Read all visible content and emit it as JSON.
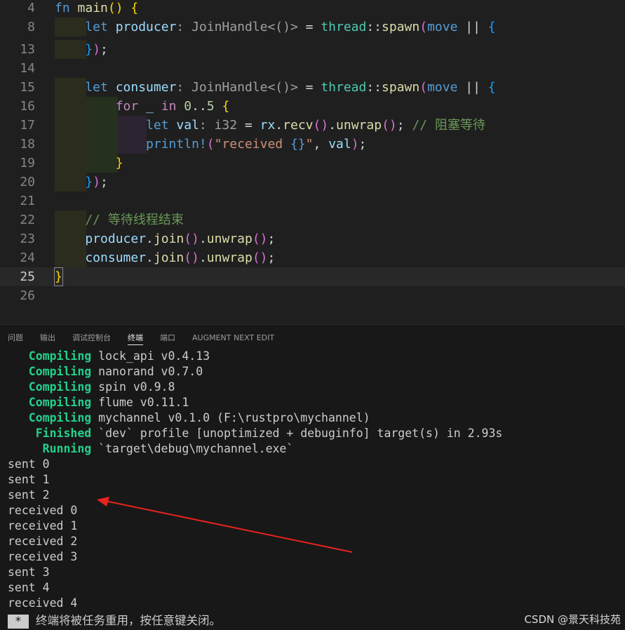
{
  "editor": {
    "lines": [
      {
        "num": "4",
        "parts": [
          [
            "kw",
            "fn "
          ],
          [
            "fn",
            "main"
          ],
          [
            "br1",
            "() {"
          ]
        ]
      },
      {
        "num": "8",
        "parts": [
          [
            "kw",
            "    let "
          ],
          [
            "var",
            "producer"
          ],
          [
            "hint",
            ": JoinHandle<()>"
          ],
          [
            "op",
            " = "
          ],
          [
            "type",
            "thread"
          ],
          [
            "op",
            "::"
          ],
          [
            "fn",
            "spawn"
          ],
          [
            "br2",
            "("
          ],
          [
            "kw",
            "move "
          ],
          [
            "op",
            "|| "
          ],
          [
            "br3",
            "{"
          ]
        ]
      },
      {
        "num": "13",
        "parts": [
          [
            "br3",
            "    }"
          ],
          [
            "br2",
            ")"
          ],
          [
            "op",
            ";"
          ]
        ]
      },
      {
        "num": "14",
        "parts": []
      },
      {
        "num": "15",
        "parts": [
          [
            "kw",
            "    let "
          ],
          [
            "var",
            "consumer"
          ],
          [
            "hint",
            ": JoinHandle<()>"
          ],
          [
            "op",
            " = "
          ],
          [
            "type",
            "thread"
          ],
          [
            "op",
            "::"
          ],
          [
            "fn",
            "spawn"
          ],
          [
            "br2",
            "("
          ],
          [
            "kw",
            "move "
          ],
          [
            "op",
            "|| "
          ],
          [
            "br3",
            "{"
          ]
        ]
      },
      {
        "num": "16",
        "parts": [
          [
            "ctrl",
            "        for "
          ],
          [
            "var",
            "_ "
          ],
          [
            "ctrl",
            "in "
          ],
          [
            "num",
            "0"
          ],
          [
            "op",
            ".."
          ],
          [
            "num",
            "5 "
          ],
          [
            "br1",
            "{"
          ]
        ]
      },
      {
        "num": "17",
        "parts": [
          [
            "kw",
            "            let "
          ],
          [
            "var",
            "val"
          ],
          [
            "hint",
            ": i32"
          ],
          [
            "op",
            " = "
          ],
          [
            "var",
            "rx"
          ],
          [
            "op",
            "."
          ],
          [
            "fn",
            "recv"
          ],
          [
            "br2",
            "()"
          ],
          [
            "op",
            "."
          ],
          [
            "fn",
            "unwrap"
          ],
          [
            "br2",
            "()"
          ],
          [
            "op",
            "; "
          ],
          [
            "cmt",
            "// 阻塞等待"
          ]
        ]
      },
      {
        "num": "18",
        "parts": [
          [
            "mac",
            "            println!"
          ],
          [
            "br2",
            "("
          ],
          [
            "str",
            "\"received "
          ],
          [
            "kw",
            "{}"
          ],
          [
            "str",
            "\""
          ],
          [
            "op",
            ", "
          ],
          [
            "var",
            "val"
          ],
          [
            "br2",
            ")"
          ],
          [
            "op",
            ";"
          ]
        ]
      },
      {
        "num": "19",
        "parts": [
          [
            "br1",
            "        }"
          ]
        ]
      },
      {
        "num": "20",
        "parts": [
          [
            "br3",
            "    }"
          ],
          [
            "br2",
            ")"
          ],
          [
            "op",
            ";"
          ]
        ]
      },
      {
        "num": "21",
        "parts": []
      },
      {
        "num": "22",
        "parts": [
          [
            "cmt",
            "    // 等待线程结束"
          ]
        ]
      },
      {
        "num": "23",
        "parts": [
          [
            "var",
            "    producer"
          ],
          [
            "op",
            "."
          ],
          [
            "fn",
            "join"
          ],
          [
            "br2",
            "()"
          ],
          [
            "op",
            "."
          ],
          [
            "fn",
            "unwrap"
          ],
          [
            "br2",
            "()"
          ],
          [
            "op",
            ";"
          ]
        ]
      },
      {
        "num": "24",
        "parts": [
          [
            "var",
            "    consumer"
          ],
          [
            "op",
            "."
          ],
          [
            "fn",
            "join"
          ],
          [
            "br2",
            "()"
          ],
          [
            "op",
            "."
          ],
          [
            "fn",
            "unwrap"
          ],
          [
            "br2",
            "()"
          ],
          [
            "op",
            ";"
          ]
        ]
      },
      {
        "num": "25",
        "parts": [
          [
            "br1",
            "}"
          ]
        ]
      },
      {
        "num": "26",
        "parts": []
      }
    ],
    "active_line": "25"
  },
  "panel": {
    "tabs": [
      "问题",
      "输出",
      "调试控制台",
      "终端",
      "端口",
      "AUGMENT NEXT EDIT"
    ],
    "active_tab": "终端",
    "terminal": [
      {
        "label": "   Compiling",
        "text": " lock_api v0.4.13"
      },
      {
        "label": "   Compiling",
        "text": " nanorand v0.7.0"
      },
      {
        "label": "   Compiling",
        "text": " spin v0.9.8"
      },
      {
        "label": "   Compiling",
        "text": " flume v0.11.1"
      },
      {
        "label": "   Compiling",
        "text": " mychannel v0.1.0 (F:\\rustpro\\mychannel)"
      },
      {
        "label": "    Finished",
        "text": " `dev` profile [unoptimized + debuginfo] target(s) in 2.93s"
      },
      {
        "label": "     Running",
        "text": " `target\\debug\\mychannel.exe`"
      },
      {
        "label": "",
        "text": "sent 0"
      },
      {
        "label": "",
        "text": "sent 1"
      },
      {
        "label": "",
        "text": "sent 2"
      },
      {
        "label": "",
        "text": "received 0"
      },
      {
        "label": "",
        "text": "received 1"
      },
      {
        "label": "",
        "text": "received 2"
      },
      {
        "label": "",
        "text": "received 3"
      },
      {
        "label": "",
        "text": "sent 3"
      },
      {
        "label": "",
        "text": "sent 4"
      },
      {
        "label": "",
        "text": "received 4"
      }
    ],
    "notice_star": "*",
    "notice_text": "终端将被任务重用，按任意键关闭。"
  },
  "watermark": "CSDN @景天科技苑",
  "colors": {
    "accent_green": "#23d18b",
    "arrow": "#e8231e"
  }
}
